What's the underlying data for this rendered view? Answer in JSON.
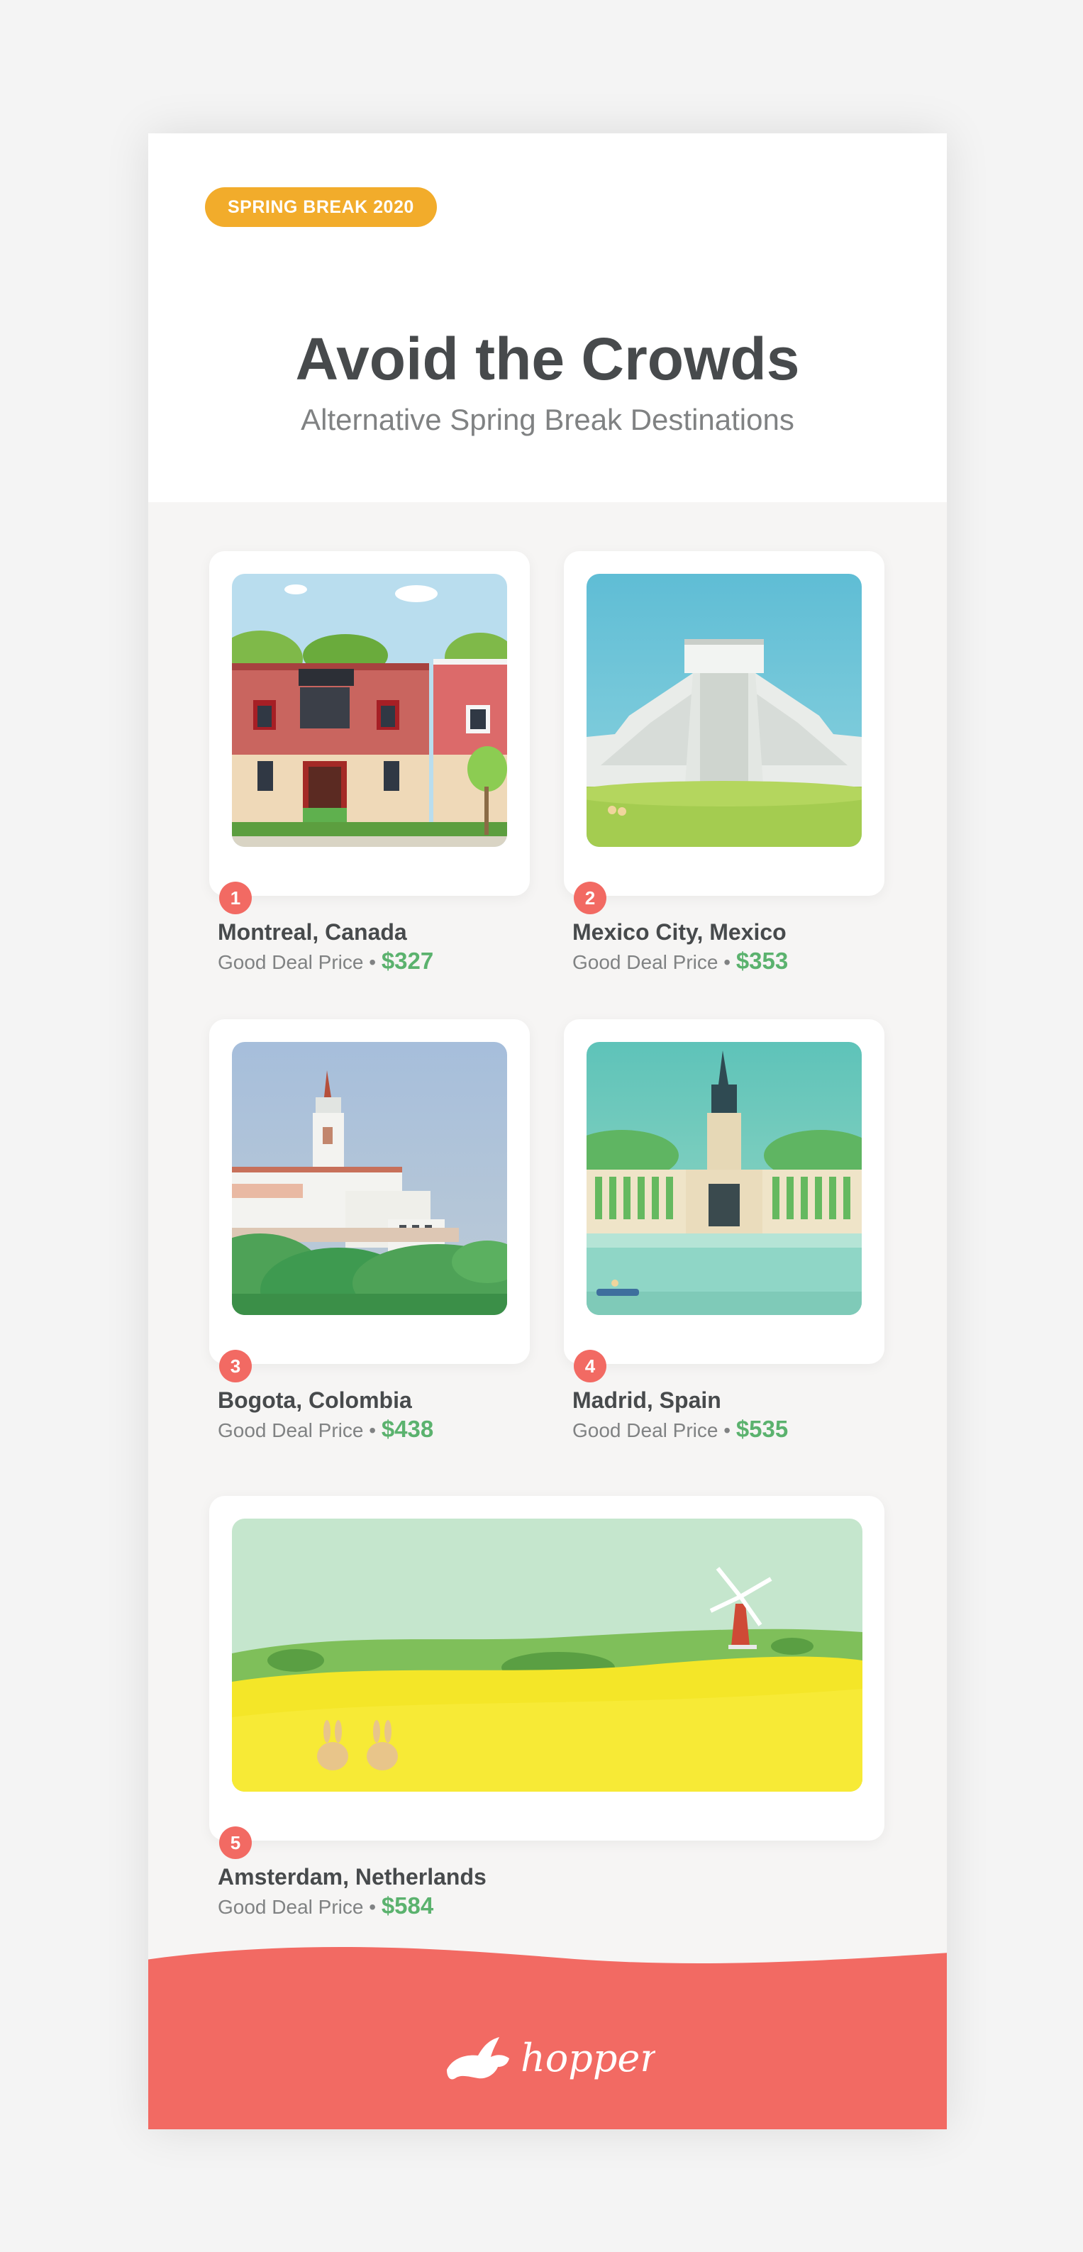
{
  "header": {
    "badge": "SPRING BREAK 2020",
    "title": "Avoid the Crowds",
    "subtitle": "Alternative Spring Break Destinations"
  },
  "destinations": [
    {
      "number": "1",
      "city": "Montreal, Canada",
      "price_label": "Good Deal Price",
      "separator": "•",
      "price": "$327",
      "illustration": "montreal-townhouse"
    },
    {
      "number": "2",
      "city": "Mexico City, Mexico",
      "price_label": "Good Deal Price",
      "separator": "•",
      "price": "$353",
      "illustration": "mexico-pyramid"
    },
    {
      "number": "3",
      "city": "Bogota, Colombia",
      "price_label": "Good Deal Price",
      "separator": "•",
      "price": "$438",
      "illustration": "bogota-church"
    },
    {
      "number": "4",
      "city": "Madrid, Spain",
      "price_label": "Good Deal Price",
      "separator": "•",
      "price": "$535",
      "illustration": "madrid-monument"
    },
    {
      "number": "5",
      "city": "Amsterdam, Netherlands",
      "price_label": "Good Deal Price",
      "separator": "•",
      "price": "$584",
      "illustration": "amsterdam-windmill"
    }
  ],
  "footer": {
    "logo_text": "hopper",
    "logo_icon": "bunny-icon"
  },
  "colors": {
    "accent": "#f26a63",
    "badge": "#f2ac2b",
    "price": "#5bb26e",
    "title": "#474a4c"
  }
}
